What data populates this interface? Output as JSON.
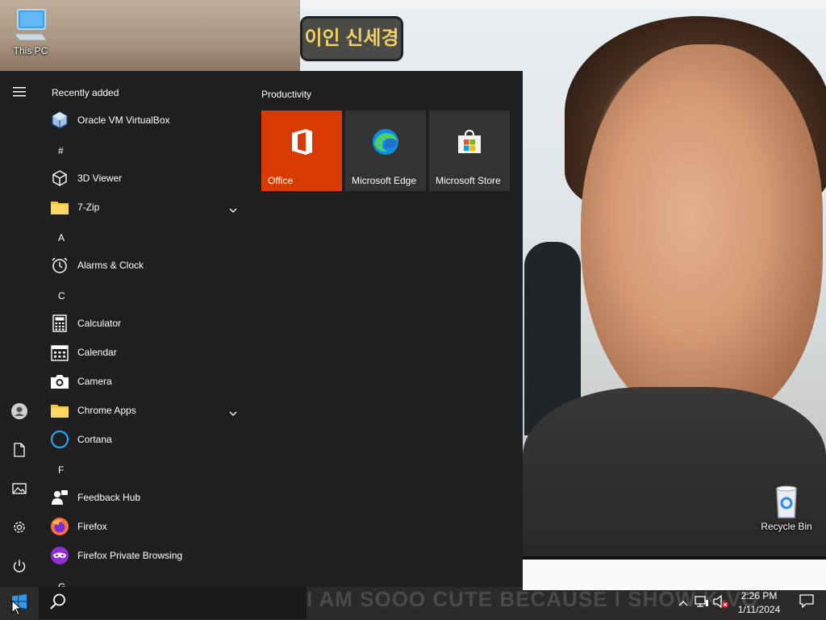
{
  "wallpaper": {
    "badge_text": "이인 신세경",
    "caption_text": "I AM SOOO CUTE BECAUSE I SHOW K-VO"
  },
  "desktop": {
    "icons": [
      {
        "label": "This PC",
        "icon": "computer-icon"
      },
      {
        "label": "Recycle Bin",
        "icon": "recycle-bin-icon"
      }
    ]
  },
  "start_menu": {
    "rail": [
      {
        "icon": "hamburger-menu-icon"
      },
      {
        "icon": "user-account-icon"
      },
      {
        "icon": "documents-icon"
      },
      {
        "icon": "pictures-icon"
      },
      {
        "icon": "settings-gear-icon"
      },
      {
        "icon": "power-icon"
      }
    ],
    "recently_added_heading": "Recently added",
    "recent": [
      {
        "label": "Oracle VM VirtualBox",
        "icon": "virtualbox-icon"
      }
    ],
    "letters": [
      "#",
      "A",
      "C",
      "F",
      "G"
    ],
    "apps": [
      {
        "label": "3D Viewer",
        "icon": "cube-icon"
      },
      {
        "label": "7-Zip",
        "icon": "folder-icon",
        "expandable": true
      },
      {
        "label": "Alarms & Clock",
        "icon": "alarm-clock-icon"
      },
      {
        "label": "Calculator",
        "icon": "calculator-icon"
      },
      {
        "label": "Calendar",
        "icon": "calendar-icon"
      },
      {
        "label": "Camera",
        "icon": "camera-icon"
      },
      {
        "label": "Chrome Apps",
        "icon": "folder-icon",
        "expandable": true
      },
      {
        "label": "Cortana",
        "icon": "cortana-ring-icon"
      },
      {
        "label": "Feedback Hub",
        "icon": "feedback-hub-icon"
      },
      {
        "label": "Firefox",
        "icon": "firefox-icon"
      },
      {
        "label": "Firefox Private Browsing",
        "icon": "firefox-private-icon"
      }
    ],
    "tile_group": {
      "title": "Productivity",
      "tiles": [
        {
          "label": "Office",
          "icon": "office-icon",
          "color": "#d83b01"
        },
        {
          "label": "Microsoft Edge",
          "icon": "edge-icon",
          "color": "#333333"
        },
        {
          "label": "Microsoft Store",
          "icon": "store-bag-icon",
          "color": "#333333"
        }
      ]
    }
  },
  "taskbar": {
    "start_icon": "windows-logo-icon",
    "search_icon": "search-icon",
    "tray": {
      "icons": [
        "chevron-up-icon",
        "network-icon",
        "volume-muted-icon"
      ],
      "time": "2:26 PM",
      "date": "1/11/2024",
      "notification_icon": "action-center-icon"
    }
  },
  "colors": {
    "menu_bg": "#1f1f1f",
    "office_tile": "#d83b01",
    "tile_dark": "#333333",
    "folder": "#f4c542"
  }
}
